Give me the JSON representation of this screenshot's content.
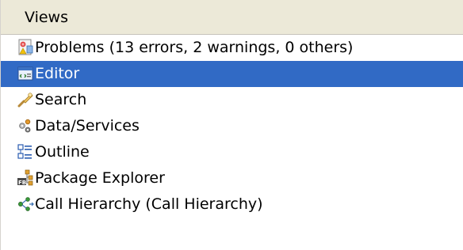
{
  "panel": {
    "header": "Views"
  },
  "items": [
    {
      "label": "Problems (13 errors, 2 warnings, 0 others)",
      "icon": "problems-icon",
      "selected": false
    },
    {
      "label": "Editor",
      "icon": "editor-icon",
      "selected": true
    },
    {
      "label": "Search",
      "icon": "search-icon",
      "selected": false
    },
    {
      "label": "Data/Services",
      "icon": "data-services-icon",
      "selected": false
    },
    {
      "label": "Outline",
      "icon": "outline-icon",
      "selected": false
    },
    {
      "label": "Package Explorer",
      "icon": "package-explorer-icon",
      "selected": false
    },
    {
      "label": "Call Hierarchy (Call Hierarchy)",
      "icon": "call-hierarchy-icon",
      "selected": false
    }
  ],
  "colors": {
    "selection": "#316ac5",
    "header_bg": "#ece9d8"
  }
}
